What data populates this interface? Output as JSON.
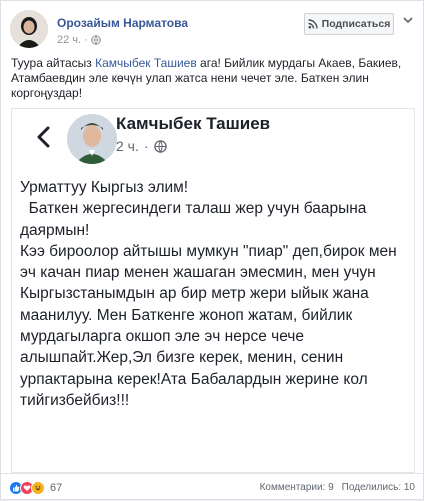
{
  "post": {
    "author": "Орозайым Нарматова",
    "time": "22 ч.",
    "subscribe_label": "Подписаться",
    "text_before": "Туура айтасыз ",
    "mention": "Камчыбек Ташиев",
    "text_after": " ага! Бийлик мурдагы Акаев, Бакиев, Атамбаевдин эле көчүн улап жатса нени чечет эле. Баткен элин коргоңуздар!"
  },
  "shared": {
    "author": "Камчыбек Ташиев",
    "time": "2 ч.",
    "paragraphs": [
      "Урматтуу Кыргыз элим!",
      "  Баткен жергесиндеги талаш жер учун баарына даярмын!",
      "Кээ бироолор айтышы мумкун \"пиар\" деп,бирок мен эч качан пиар менен жашаган эмесмин, мен учун Кыргызстанымдын ар бир метр жери ыйык жана маанилуу. Мен Баткенге жоноп жатам, бийлик мурдагыларга окшоп эле эч нерсе чече алышпайт.Жер,Эл бизге керек, менин, сенин урпактарына керек!Ата Бабалардын жерине кол тийгизбейбиз!!!"
    ]
  },
  "footer": {
    "reaction_count": "67",
    "comments_label": "Комментарии: 9",
    "shares_label": "Поделились: 10"
  },
  "colors": {
    "link": "#385898",
    "like": "#1877f2",
    "love": "#f33e58",
    "haha": "#f7b125"
  },
  "icons": [
    "back-arrow-icon",
    "globe-icon",
    "rss-icon",
    "chevron-down-icon",
    "like-reaction-icon",
    "love-reaction-icon",
    "haha-reaction-icon"
  ]
}
